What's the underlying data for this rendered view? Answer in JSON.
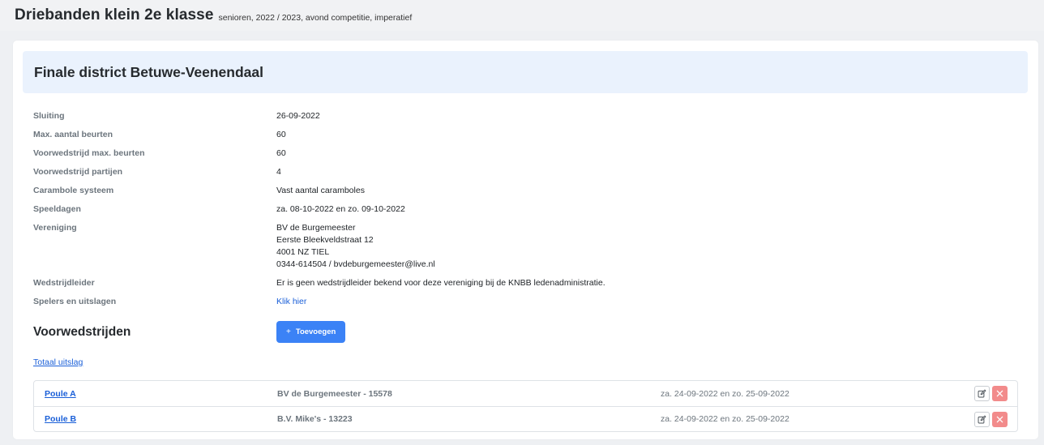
{
  "header": {
    "title": "Driebanden klein 2e klasse",
    "subtitle": "senioren, 2022 / 2023, avond competitie, imperatief"
  },
  "card": {
    "title": "Finale district Betuwe-Veenendaal"
  },
  "details": [
    {
      "label": "Sluiting",
      "value": "26-09-2022"
    },
    {
      "label": "Max. aantal beurten",
      "value": "60"
    },
    {
      "label": "Voorwedstrijd max. beurten",
      "value": "60"
    },
    {
      "label": "Voorwedstrijd partijen",
      "value": "4"
    },
    {
      "label": "Carambole systeem",
      "value": "Vast aantal caramboles"
    },
    {
      "label": "Speeldagen",
      "value": "za. 08-10-2022 en zo. 09-10-2022"
    }
  ],
  "vereniging": {
    "label": "Vereniging",
    "lines": [
      "BV de Burgemeester",
      "Eerste Bleekveldstraat 12",
      "4001 NZ TIEL",
      "0344-614504 / bvdeburgemeester@live.nl"
    ]
  },
  "wedstrijdleider": {
    "label": "Wedstrijdleider",
    "value": "Er is geen wedstrijdleider bekend voor deze vereniging bij de KNBB ledenadministratie."
  },
  "spelers": {
    "label": "Spelers en uitslagen",
    "link": "Klik hier"
  },
  "voorwedstrijden": {
    "title": "Voorwedstrijden",
    "add_icon": "+",
    "add_label": "Toevoegen",
    "totaal_link": "Totaal uitslag",
    "items": [
      {
        "name": "Poule A",
        "club": "BV de Burgemeester - 15578",
        "date": "za. 24-09-2022 en zo. 25-09-2022"
      },
      {
        "name": "Poule B",
        "club": "B.V. Mike's - 13223",
        "date": "za. 24-09-2022 en zo. 25-09-2022"
      }
    ]
  },
  "icons": {
    "edit": "edit-icon",
    "delete": "close-icon"
  },
  "colors": {
    "primary": "#3b82f6",
    "link": "#1a5fd8",
    "danger": "#f28b8b",
    "header_bg": "#eaf2fd"
  }
}
